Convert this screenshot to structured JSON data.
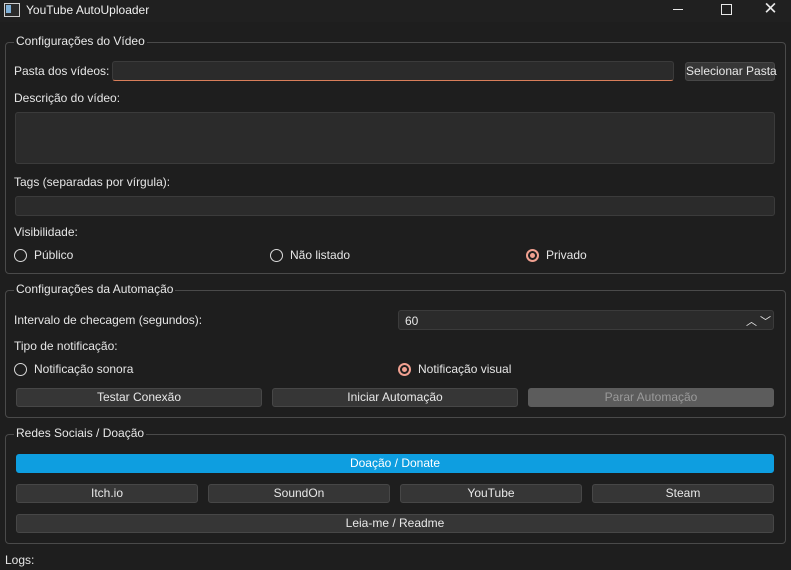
{
  "window": {
    "title": "YouTube AutoUploader"
  },
  "video_config": {
    "legend": "Configurações do Vídeo",
    "folder_label": "Pasta dos vídeos:",
    "folder_value": "",
    "select_folder_button": "Selecionar Pasta",
    "description_label": "Descrição do vídeo:",
    "description_value": "",
    "tags_label": "Tags (separadas por vírgula):",
    "tags_value": "",
    "visibility_label": "Visibilidade:",
    "visibility_options": [
      "Público",
      "Não listado",
      "Privado"
    ],
    "visibility_selected": "Privado"
  },
  "automation_config": {
    "legend": "Configurações da Automação",
    "interval_label": "Intervalo de checagem (segundos):",
    "interval_value": "60",
    "notification_label": "Tipo de notificação:",
    "notification_options": [
      "Notificação sonora",
      "Notificação visual"
    ],
    "notification_selected": "Notificação visual",
    "test_button": "Testar Conexão",
    "start_button": "Iniciar Automação",
    "stop_button": "Parar Automação"
  },
  "social": {
    "legend": "Redes Sociais / Doação",
    "donate_button": "Doação / Donate",
    "links": [
      "Itch.io",
      "SoundOn",
      "YouTube",
      "Steam"
    ],
    "readme_button": "Leia-me / Readme"
  },
  "logs": {
    "label": "Logs:"
  },
  "colors": {
    "accent": "#0e9ee0",
    "radio_checked": "#f0a090",
    "focus_underline": "#d97e5a"
  }
}
